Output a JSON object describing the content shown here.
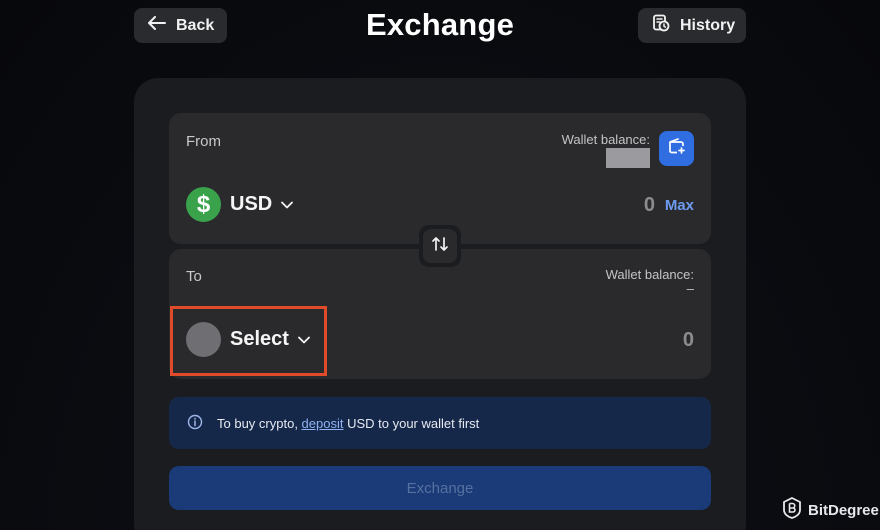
{
  "header": {
    "back_label": "Back",
    "title": "Exchange",
    "history_label": "History"
  },
  "from": {
    "label": "From",
    "wallet_balance_label": "Wallet balance:",
    "currency": "USD",
    "currency_symbol": "$",
    "amount": "0",
    "max_label": "Max"
  },
  "to": {
    "label": "To",
    "wallet_balance_label": "Wallet balance:",
    "wallet_balance_value": "–",
    "currency": "Select",
    "amount": "0"
  },
  "info": {
    "text_before": "To buy crypto, ",
    "link": "deposit",
    "text_after": " USD to your wallet first"
  },
  "exchange_button_label": "Exchange",
  "watermark": "BitDegree",
  "colors": {
    "accent": "#2f6de1",
    "usd_coin": "#3aa24b",
    "highlight": "#e04b2b",
    "info_bg": "#16284a"
  }
}
